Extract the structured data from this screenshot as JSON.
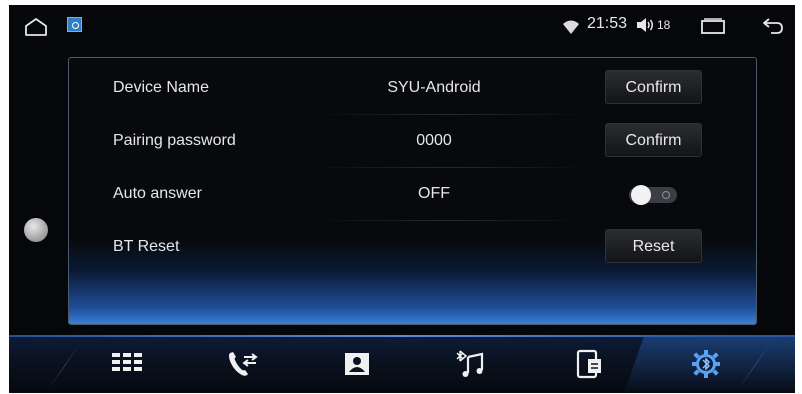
{
  "status_bar": {
    "time": "21:53",
    "volume": "18",
    "icons": [
      "home-icon",
      "app-icon",
      "wifi-icon",
      "volume-icon",
      "recents-icon",
      "back-icon"
    ]
  },
  "settings": {
    "rows": [
      {
        "label": "Device Name",
        "value": "SYU-Android",
        "button": "Confirm"
      },
      {
        "label": "Pairing password",
        "value": "0000",
        "button": "Confirm"
      },
      {
        "label": "Auto answer",
        "value": "OFF",
        "toggle_on": false
      },
      {
        "label": "BT Reset",
        "value": "",
        "button": "Reset"
      }
    ]
  },
  "dock": {
    "items": [
      "dialpad-icon",
      "call-log-icon",
      "contacts-icon",
      "bluetooth-music-icon",
      "phone-transfer-icon",
      "bluetooth-settings-icon"
    ],
    "active_index": 5,
    "accent": "#3f86e6"
  }
}
